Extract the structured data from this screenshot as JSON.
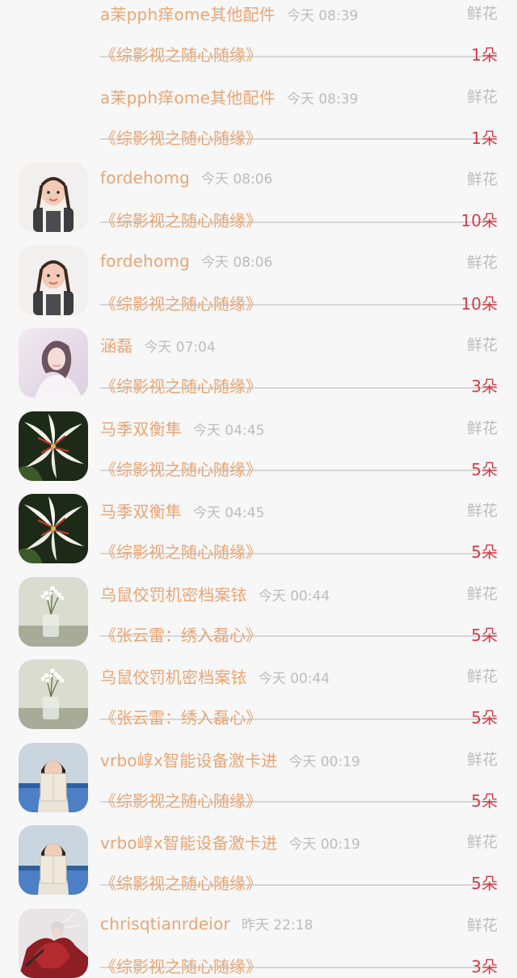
{
  "gift_list": [
    {
      "name": "a茉pph痒ome其他配件",
      "time": "今天 08:39",
      "gift": "鲜花",
      "work": "《综影视之随心随缘》",
      "count": "1朵",
      "avatar": "none"
    },
    {
      "name": "a茉pph痒ome其他配件",
      "time": "今天 08:39",
      "gift": "鲜花",
      "work": "《综影视之随心随缘》",
      "count": "1朵",
      "avatar": "none"
    },
    {
      "name": "fordehomg",
      "time": "今天 08:06",
      "gift": "鲜花",
      "work": "《综影视之随心随缘》",
      "count": "10朵",
      "avatar": "girl-braids"
    },
    {
      "name": "fordehomg",
      "time": "今天 08:06",
      "gift": "鲜花",
      "work": "《综影视之随心随缘》",
      "count": "10朵",
      "avatar": "girl-braids"
    },
    {
      "name": "涵磊",
      "time": "今天 07:04",
      "gift": "鲜花",
      "work": "《综影视之随心随缘》",
      "count": "3朵",
      "avatar": "woman-soft"
    },
    {
      "name": "马季双衡隼",
      "time": "今天 04:45",
      "gift": "鲜花",
      "work": "《综影视之随心随缘》",
      "count": "5朵",
      "avatar": "lily-flower"
    },
    {
      "name": "马季双衡隼",
      "time": "今天 04:45",
      "gift": "鲜花",
      "work": "《综影视之随心随缘》",
      "count": "5朵",
      "avatar": "lily-flower"
    },
    {
      "name": "乌鼠佼罚机密档案铱",
      "time": "今天 00:44",
      "gift": "鲜花",
      "work": "《张云雷：绣入磊心》",
      "count": "5朵",
      "avatar": "white-flowers-vase"
    },
    {
      "name": "乌鼠佼罚机密档案铱",
      "time": "今天 00:44",
      "gift": "鲜花",
      "work": "《张云雷：绣入磊心》",
      "count": "5朵",
      "avatar": "white-flowers-vase"
    },
    {
      "name": "vrbo崞x智能设备激卡进",
      "time": "今天 00:19",
      "gift": "鲜花",
      "work": "《综影视之随心随缘》",
      "count": "5朵",
      "avatar": "girl-book"
    },
    {
      "name": "vrbo崞x智能设备激卡进",
      "time": "今天 00:19",
      "gift": "鲜花",
      "work": "《综影视之随心随缘》",
      "count": "5朵",
      "avatar": "girl-book"
    },
    {
      "name": "chrisqtianrdeior",
      "time": "昨天 22:18",
      "gift": "鲜花",
      "work": "《综影视之随心随缘》",
      "count": "3朵",
      "avatar": "red-warrior"
    }
  ],
  "colors": {
    "name": "#e8a574",
    "time": "#bcbcbc",
    "count": "#d23d48",
    "divider": "#d6d6d6",
    "background": "#f7f7f7"
  }
}
